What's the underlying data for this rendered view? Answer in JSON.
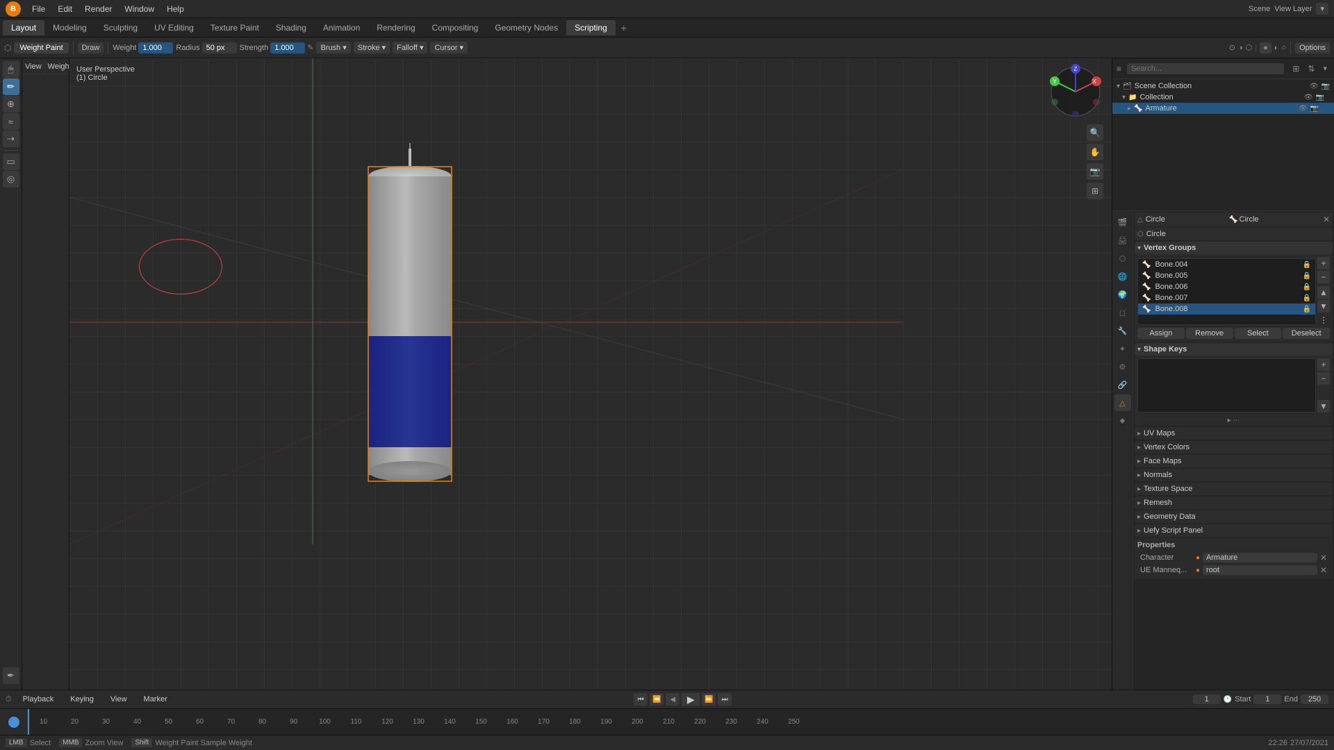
{
  "app": {
    "title": "Blender",
    "logo": "B",
    "menu_items": [
      "File",
      "Edit",
      "Render",
      "Window",
      "Help"
    ]
  },
  "workspace_tabs": [
    {
      "label": "Layout",
      "active": false
    },
    {
      "label": "Modeling",
      "active": false
    },
    {
      "label": "Sculpting",
      "active": false
    },
    {
      "label": "UV Editing",
      "active": false
    },
    {
      "label": "Texture Paint",
      "active": false
    },
    {
      "label": "Shading",
      "active": false
    },
    {
      "label": "Animation",
      "active": false
    },
    {
      "label": "Rendering",
      "active": false
    },
    {
      "label": "Compositing",
      "active": false
    },
    {
      "label": "Geometry Nodes",
      "active": false
    },
    {
      "label": "Scripting",
      "active": false
    }
  ],
  "toolbar": {
    "mode": "Weight Paint",
    "draw_label": "Draw",
    "weight_label": "Weight",
    "weight_val": "1.000",
    "radius_label": "Radius",
    "radius_val": "50 px",
    "strength_label": "Strength",
    "strength_val": "1.000",
    "brush_label": "Brush",
    "stroke_label": "Stroke",
    "falloff_label": "Falloff",
    "cursor_label": "Cursor",
    "options_label": "Options",
    "x_label": "X",
    "y_label": "Y",
    "z_label": "Z",
    "view_label": "View",
    "weights_label": "Weights"
  },
  "viewport": {
    "label_line1": "User Perspective",
    "label_line2": "(1) Circle"
  },
  "outliner": {
    "search_placeholder": "Search...",
    "scene_collection_label": "Scene Collection",
    "collection_label": "Collection",
    "armature_label": "Armature"
  },
  "properties": {
    "object_name": "Circle",
    "object_data_name": "Circle",
    "mesh_name": "Circle",
    "vertex_groups_label": "Vertex Groups",
    "vertex_groups": [
      {
        "name": "Bone.004"
      },
      {
        "name": "Bone.005"
      },
      {
        "name": "Bone.006"
      },
      {
        "name": "Bone.007"
      },
      {
        "name": "Bone.008"
      }
    ],
    "shape_keys_label": "Shape Keys",
    "uv_maps_label": "UV Maps",
    "vertex_colors_label": "Vertex Colors",
    "face_maps_label": "Face Maps",
    "normals_label": "Normals",
    "texture_space_label": "Texture Space",
    "remesh_label": "Remesh",
    "geometry_data_label": "Geometry Data",
    "uefy_script_panel_label": "Uefy Script Panel",
    "properties_label": "Properties",
    "character_label": "Character",
    "character_val": "Armature",
    "ue_mannequin_label": "UE Manneq...",
    "ue_mannequin_val": "root"
  },
  "timeline": {
    "playback_label": "Playback",
    "keying_label": "Keying",
    "view_label": "View",
    "marker_label": "Marker",
    "current_frame": "1",
    "start_label": "Start",
    "start_val": "1",
    "end_label": "End",
    "end_val": "250",
    "frame_numbers": [
      "",
      "10",
      "20",
      "30",
      "40",
      "50",
      "60",
      "70",
      "80",
      "90",
      "100",
      "110",
      "120",
      "130",
      "140",
      "150",
      "160",
      "170",
      "180",
      "190",
      "200",
      "210",
      "220",
      "230",
      "240",
      "250"
    ]
  },
  "status_bar": {
    "select_label": "Select",
    "zoom_view_label": "Zoom View",
    "weight_paint_sample_label": "Weight Paint Sample Weight",
    "time": "22:26",
    "date": "27/07/2021"
  }
}
